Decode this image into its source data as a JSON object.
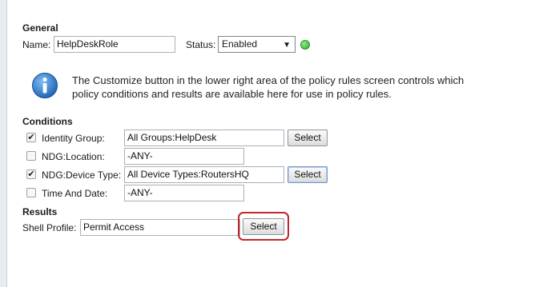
{
  "general": {
    "heading": "General",
    "name_label": "Name:",
    "name_value": "HelpDeskRole",
    "status_label": "Status:",
    "status_value": "Enabled",
    "status_color": "#2fa82a"
  },
  "info": {
    "icon": "info-icon",
    "line1": "The Customize button in the lower right area of the policy rules screen controls which",
    "line2": "policy conditions and results are available here for use in policy rules."
  },
  "conditions": {
    "heading": "Conditions",
    "rows": [
      {
        "label": "Identity Group:",
        "checked": true,
        "value": "All Groups:HelpDesk",
        "button": "Select"
      },
      {
        "label": "NDG:Location:",
        "checked": false,
        "value": "-ANY-"
      },
      {
        "label": "NDG:Device Type:",
        "checked": true,
        "value": "All Device Types:RoutersHQ",
        "button": "Select"
      },
      {
        "label": "Time And Date:",
        "checked": false,
        "value": "-ANY-"
      }
    ]
  },
  "results": {
    "heading": "Results",
    "shell_profile_label": "Shell Profile:",
    "shell_profile_value": "Permit Access",
    "select_label": "Select",
    "highlight_color": "#c0262d"
  }
}
